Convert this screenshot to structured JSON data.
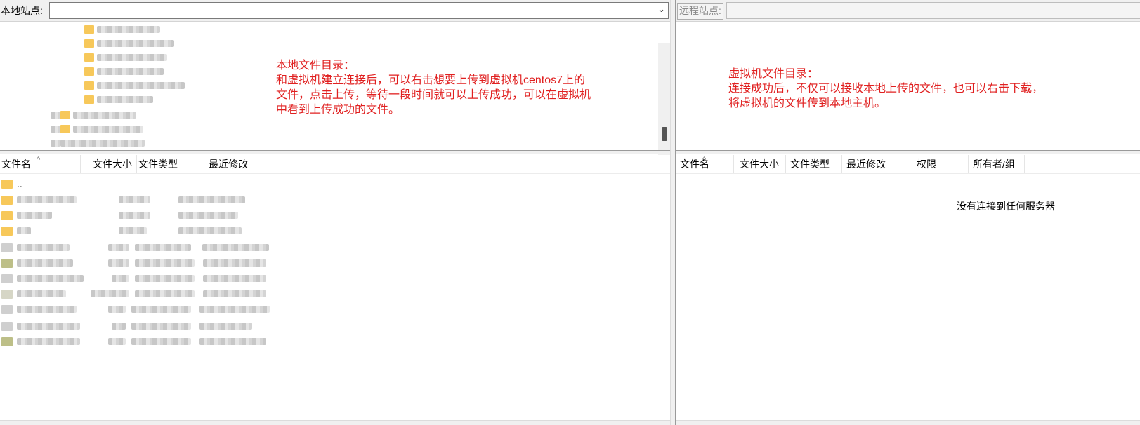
{
  "local_site": {
    "label": "本地站点:",
    "path": ""
  },
  "remote_site": {
    "label": "远程站点:",
    "path": ""
  },
  "annotations": {
    "local": "本地文件目录：\n和虚拟机建立连接后，可以右击想要上传到虚拟机centos7上的\n文件，点击上传，等待一段时间就可以上传成功，可以在虚拟机\n中看到上传成功的文件。",
    "remote": "虚拟机文件目录：\n连接成功后，不仅可以接收本地上传的文件，也可以右击下载，\n将虚拟机的文件传到本地主机。"
  },
  "local_list": {
    "columns": [
      "文件名",
      "文件大小",
      "文件类型",
      "最近修改"
    ],
    "parent_dir": ".."
  },
  "remote_list": {
    "columns": [
      "文件名",
      "文件大小",
      "文件类型",
      "最近修改",
      "权限",
      "所有者/组"
    ],
    "empty_message": "没有连接到任何服务器"
  },
  "colors": {
    "annotation": "#e02020",
    "folder": "#f7c85a"
  },
  "icons": {
    "sort": "chevron-up-icon",
    "dropdown": "chevron-down-icon",
    "folder": "folder-icon"
  }
}
